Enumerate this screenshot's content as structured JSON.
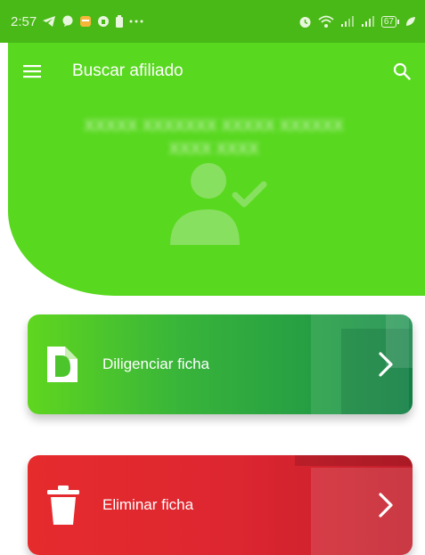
{
  "statusbar": {
    "time": "2:57",
    "left_icons": [
      "telegram-icon",
      "chat-bubble-icon",
      "notes-app-icon",
      "vpn-icon",
      "battery-saver-icon",
      "more-notifications-icon"
    ],
    "right_icons": [
      "alarm-icon",
      "wifi-icon",
      "signal-icon",
      "signal-icon",
      "battery-icon",
      "leaf-icon"
    ],
    "battery_level": "67"
  },
  "appbar": {
    "title": "Buscar afiliado",
    "menu_icon": "menu-icon",
    "search_icon": "search-icon"
  },
  "header": {
    "name_line1": "XXXXX XXXXXXX XXXXX XXXXXX",
    "name_line2": "XXXX XXXX",
    "avatar_icon": "user-check-icon"
  },
  "cards": [
    {
      "label": "Diligenciar ficha",
      "icon": "document-icon",
      "color": "#34b13c"
    },
    {
      "label": "Eliminar ficha",
      "icon": "trash-icon",
      "color": "#e02a2f"
    }
  ],
  "colors": {
    "primary": "#58d81f",
    "statusbar": "#49b917"
  }
}
